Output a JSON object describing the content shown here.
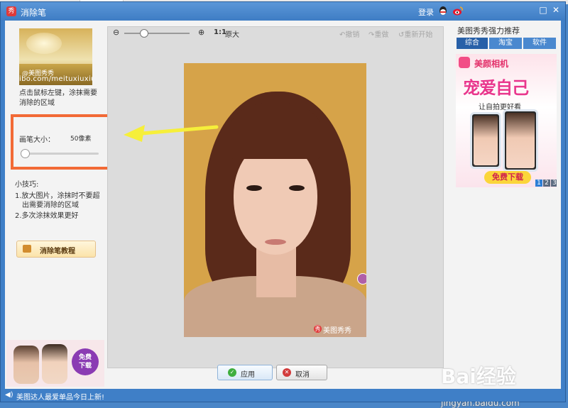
{
  "window": {
    "title": "消除笔",
    "login": "登录",
    "logo_char": "秀"
  },
  "left_panel": {
    "thumb_watermark": "@美图秀秀",
    "thumb_url": "ibo.com/meituxiuxiu",
    "instruction": "点击鼠标左键，涂抹需要消除的区域",
    "brush_label": "画笔大小：",
    "brush_value": "50像素",
    "brush_level": 0.05,
    "tips_title": "小技巧:",
    "tip1_line1": "1.放大图片，涂抹时不要超",
    "tip1_line2": "出需要消除的区域",
    "tip2": "2.多次涂抹效果更好",
    "tutorial_label": "消除笔教程",
    "ad_button": "免费下载",
    "ad_button_line1": "免费",
    "ad_button_line2": "下载"
  },
  "toolbar": {
    "one_to_one": "1:1",
    "original_size": "原大",
    "undo": "撤销",
    "redo": "重做",
    "restart": "重新开始",
    "zoom_out_glyph": "⊖",
    "zoom_in_glyph": "⊕",
    "undo_glyph": "↶",
    "redo_glyph": "↷",
    "restart_glyph": "↺"
  },
  "photo": {
    "watermark": "美图秀秀"
  },
  "actions": {
    "apply": "应用",
    "cancel": "取消"
  },
  "right_panel": {
    "title": "美图秀秀强力推荐",
    "tabs": [
      "综合",
      "淘宝",
      "软件"
    ],
    "ad_brand": "美颜相机",
    "ad_slogan": "宠爱自己",
    "ad_sub": "让自拍更好看",
    "ad_download": "免费下载",
    "ad_pages": [
      "1",
      "2",
      "3"
    ]
  },
  "status": {
    "text": "美图达人最爱单品今日上新!",
    "icon": "◀)"
  },
  "watermark_site": {
    "baidu": "Bai经验",
    "url": "jingyan.baidu.com"
  },
  "colors": {
    "title_bar": "#3f7fc7",
    "highlight_box": "#f26a36",
    "arrow": "#f6ef3a"
  }
}
